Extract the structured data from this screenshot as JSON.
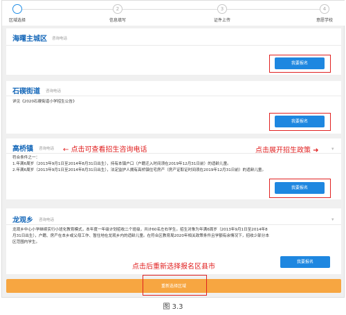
{
  "steps": [
    {
      "num": "1",
      "label": "区域选择"
    },
    {
      "num": "2",
      "label": "信息填写"
    },
    {
      "num": "3",
      "label": "证件上传"
    },
    {
      "num": "4",
      "label": "意愿学校"
    }
  ],
  "cards": {
    "haishu": {
      "title": "海曙主城区",
      "phone": "咨询电话",
      "button": "我要报名"
    },
    "shiqi": {
      "title": "石碶街道",
      "phone": "咨询电话",
      "body": "详见《2020石碶街道小学招生公告》",
      "button": "我要报名"
    },
    "gaoqiao": {
      "title": "高桥镇",
      "phone": "咨询电话",
      "body_lines": [
        "符合条件之一：",
        "1.年满6周岁（2013年9月1日至2014年8月31日出生），持有本镇户口（户籍迁入时间须在2019年12月31日前）的适龄儿童。",
        "2.年满6周岁（2013年9月1日至2014年8月31日出生），法定监护人拥有高桥镇住宅房产（房产证取证时间须在2019年12月31日前）的适龄儿童。"
      ],
      "button": "我要报名"
    },
    "longguan": {
      "title": "龙观乡",
      "phone": "咨询电话",
      "body_lines": [
        "龙观乡中心小学继续实行小班化教育模式，本年度一年级计划招收二个班级，共计60名左右学生。招生对象为年满6周岁（2013年9月1日至2014年8",
        "月31日出生），户籍、房产在本乡或父母工作、暂住地在龙观乡内的适龄儿童。在符合区教育局2020年相关政策条件且学额有余情况下，招收少部分本",
        "区范围内学生。"
      ],
      "button": "我要报名"
    }
  },
  "annotations": {
    "phone_hint": "点击可查看招生咨询电话",
    "expand_hint": "点击展开招生政策",
    "reselect_hint": "点击后重新选择报名区县市"
  },
  "reselect_button": "重新选择区域",
  "caption": "图 3.3"
}
